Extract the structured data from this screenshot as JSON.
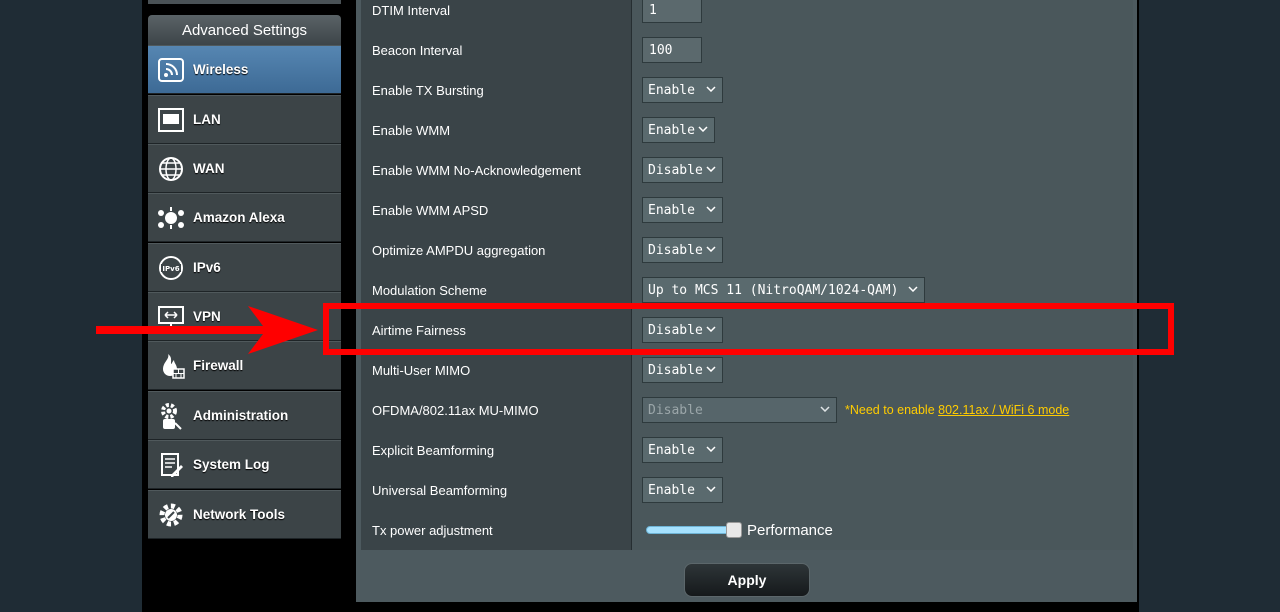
{
  "sidebar": {
    "header": "Advanced Settings",
    "items": [
      {
        "label": "Wireless",
        "icon": "wifi-icon",
        "active": true
      },
      {
        "label": "LAN",
        "icon": "lan-icon"
      },
      {
        "label": "WAN",
        "icon": "globe-icon"
      },
      {
        "label": "Amazon Alexa",
        "icon": "alexa-icon"
      },
      {
        "label": "IPv6",
        "icon": "ipv6-globe-icon"
      },
      {
        "label": "VPN",
        "icon": "vpn-icon"
      },
      {
        "label": "Firewall",
        "icon": "fire-icon"
      },
      {
        "label": "Administration",
        "icon": "admin-gear-icon"
      },
      {
        "label": "System Log",
        "icon": "log-icon"
      },
      {
        "label": "Network Tools",
        "icon": "tools-gear-icon"
      }
    ]
  },
  "settings": {
    "dtim": {
      "label": "DTIM Interval",
      "value": "1"
    },
    "beacon": {
      "label": "Beacon Interval",
      "value": "100"
    },
    "tx_bursting": {
      "label": "Enable TX Bursting",
      "value": "Enable"
    },
    "wmm": {
      "label": "Enable WMM",
      "value": "Enable"
    },
    "wmm_noack": {
      "label": "Enable WMM No-Acknowledgement",
      "value": "Disable"
    },
    "wmm_apsd": {
      "label": "Enable WMM APSD",
      "value": "Enable"
    },
    "ampdu": {
      "label": "Optimize AMPDU aggregation",
      "value": "Disable"
    },
    "modulation": {
      "label": "Modulation Scheme",
      "value": "Up to MCS 11 (NitroQAM/1024-QAM)"
    },
    "airtime": {
      "label": "Airtime Fairness",
      "value": "Disable"
    },
    "mu_mimo": {
      "label": "Multi-User MIMO",
      "value": "Disable"
    },
    "ofdma": {
      "label": "OFDMA/802.11ax MU-MIMO",
      "value": "Disable",
      "note_prefix": "*Need to enable ",
      "note_link": "802.11ax / WiFi 6 mode"
    },
    "explicit_bf": {
      "label": "Explicit Beamforming",
      "value": "Enable"
    },
    "universal_bf": {
      "label": "Universal Beamforming",
      "value": "Enable"
    },
    "tx_power": {
      "label": "Tx power adjustment",
      "value_text": "Performance",
      "level": 1.0
    }
  },
  "apply_label": "Apply",
  "colors": {
    "highlight": "#ff0000",
    "note": "#ffcc00",
    "active_nav": "#4a78a5"
  }
}
